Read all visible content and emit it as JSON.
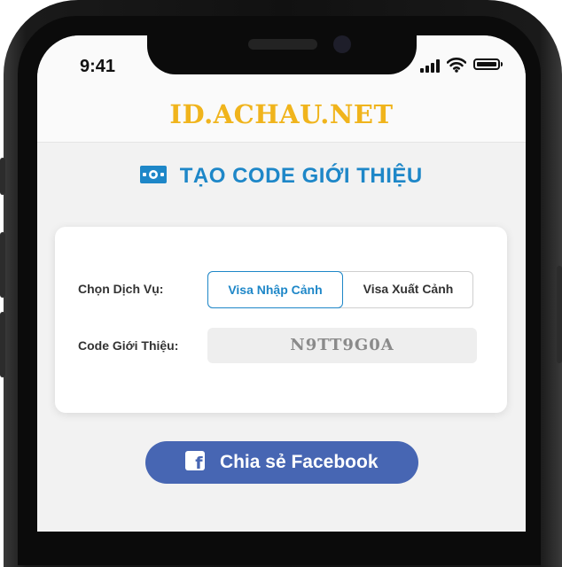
{
  "status_bar": {
    "time": "9:41",
    "signal_icon": "cellular-signal-icon",
    "wifi_icon": "wifi-icon",
    "battery_icon": "battery-icon"
  },
  "header": {
    "logo_text": "ID.ACHAU.NET"
  },
  "page": {
    "title_icon": "money-icon",
    "title": "TẠO CODE GIỚI THIỆU"
  },
  "form": {
    "service_label": "Chọn Dịch Vụ:",
    "service_options": [
      "Visa Nhập Cảnh",
      "Visa Xuất Cảnh"
    ],
    "service_selected": "Visa Nhập Cảnh",
    "code_label": "Code Giới Thiệu:",
    "code_value": "N9TT9G0A"
  },
  "share": {
    "icon": "facebook-icon",
    "label": "Chia sẻ Facebook"
  },
  "colors": {
    "accent_blue": "#1e87c8",
    "logo_yellow": "#f0b41c",
    "facebook_blue": "#4766b3",
    "page_background": "#f2f2f2"
  }
}
